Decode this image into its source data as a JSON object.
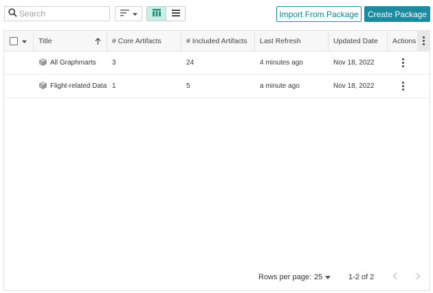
{
  "toolbar": {
    "search_placeholder": "Search",
    "import_label": "Import From Package",
    "create_label": "Create Package"
  },
  "colors": {
    "accent": "#1a8ba0",
    "view_toggle_active": "#c9efe6"
  },
  "icons": {
    "search": "search-icon",
    "sort": "sort-icon",
    "grid_view": "grid-view-icon",
    "list_view": "list-view-icon",
    "row_item": "package-cube-icon",
    "kebab": "more-vertical-icon"
  },
  "table": {
    "columns": [
      "Title",
      "# Core Artifacts",
      "# Included Artifacts",
      "Last Refresh",
      "Updated Date",
      "Actions"
    ],
    "rows": [
      {
        "title": "All Graphmarts",
        "core": "3",
        "included": "24",
        "refresh": "4 minutes ago",
        "updated": "Nov 18, 2022"
      },
      {
        "title": "Flight-related Data",
        "core": "1",
        "included": "5",
        "refresh": "a minute ago",
        "updated": "Nov 18, 2022"
      }
    ]
  },
  "pagination": {
    "rows_per_page_label": "Rows per page:",
    "rows_per_page_value": "25",
    "range": "1-2 of 2"
  }
}
